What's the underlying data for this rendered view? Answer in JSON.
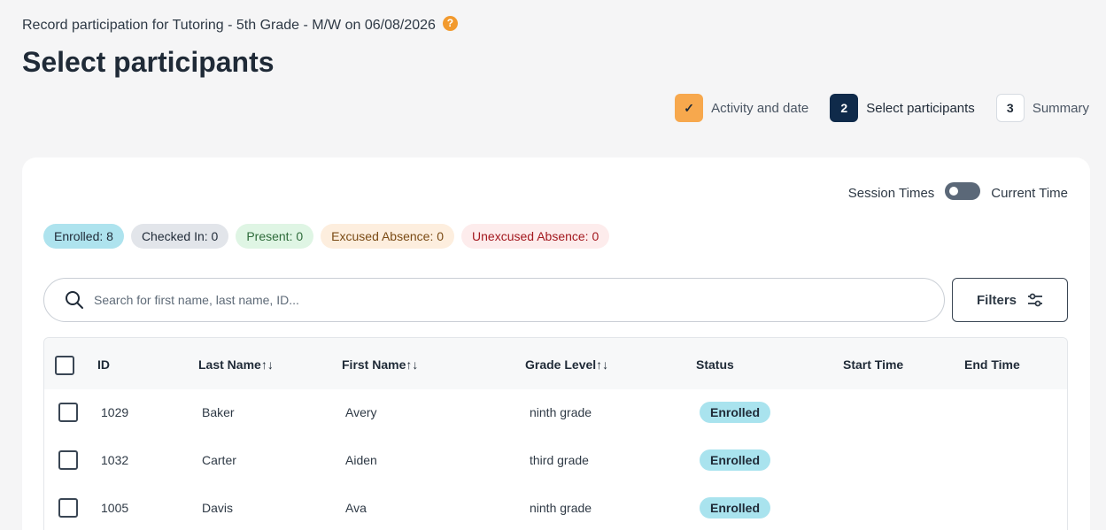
{
  "header": {
    "subtitle": "Record participation for Tutoring - 5th Grade - M/W on 06/08/2026",
    "help_icon": "?",
    "title": "Select participants"
  },
  "stepper": {
    "steps": [
      {
        "marker": "✓",
        "label": "Activity and date",
        "state": "done"
      },
      {
        "marker": "2",
        "label": "Select participants",
        "state": "active"
      },
      {
        "marker": "3",
        "label": "Summary",
        "state": "future"
      }
    ]
  },
  "toggle": {
    "left_label": "Session Times",
    "right_label": "Current Time"
  },
  "badges": [
    {
      "text": "Enrolled: 8",
      "bg": "#aee3ee",
      "color": "#1f2a37"
    },
    {
      "text": "Checked In: 0",
      "bg": "#e2e5ea",
      "color": "#1f2a37"
    },
    {
      "text": "Present: 0",
      "bg": "#dff5e4",
      "color": "#2e6b3a"
    },
    {
      "text": "Excused Absence: 0",
      "bg": "#fdeede",
      "color": "#7a4a14"
    },
    {
      "text": "Unexcused Absence: 0",
      "bg": "#fdecec",
      "color": "#a3181e"
    }
  ],
  "search": {
    "placeholder": "Search for first name, last name, ID..."
  },
  "filters": {
    "label": "Filters"
  },
  "table": {
    "columns": {
      "id": "ID",
      "last_name": "Last Name",
      "first_name": "First Name",
      "grade_level": "Grade Level",
      "status": "Status",
      "start_time": "Start Time",
      "end_time": "End Time"
    },
    "sort_glyph": "↑↓",
    "rows": [
      {
        "id": "1029",
        "last_name": "Baker",
        "first_name": "Avery",
        "grade_level": "ninth grade",
        "status": "Enrolled"
      },
      {
        "id": "1032",
        "last_name": "Carter",
        "first_name": "Aiden",
        "grade_level": "third grade",
        "status": "Enrolled"
      },
      {
        "id": "1005",
        "last_name": "Davis",
        "first_name": "Ava",
        "grade_level": "ninth grade",
        "status": "Enrolled"
      }
    ]
  }
}
